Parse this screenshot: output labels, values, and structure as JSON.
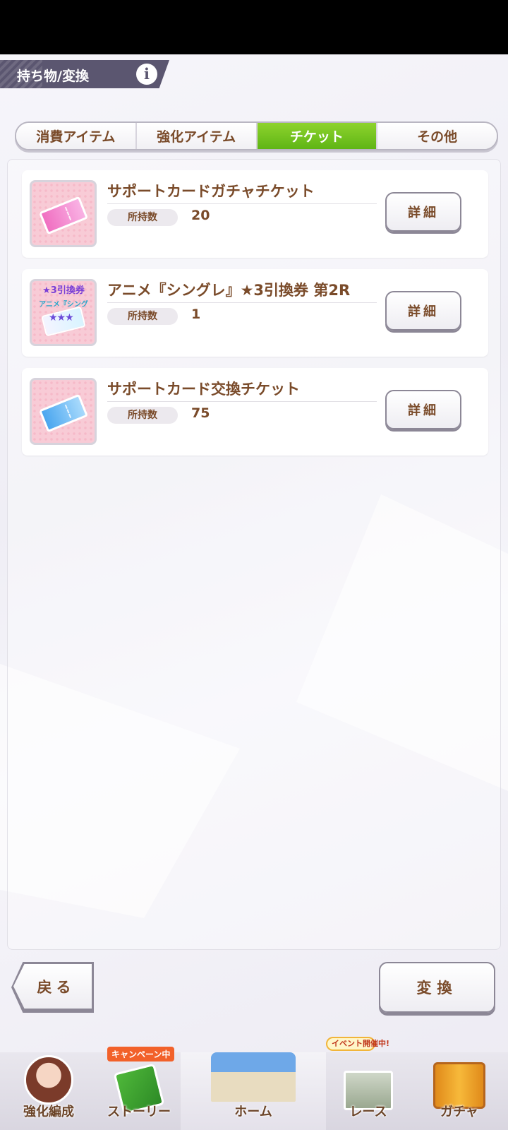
{
  "header": {
    "title": "持ち物/変換",
    "info_label": "i"
  },
  "tabs": [
    {
      "label": "消費アイテム",
      "active": false
    },
    {
      "label": "強化アイテム",
      "active": false
    },
    {
      "label": "チケット",
      "active": true
    },
    {
      "label": "その他",
      "active": false
    }
  ],
  "items": [
    {
      "name": "サポートカードガチャチケット",
      "owned_label": "所持数",
      "owned": "20",
      "detail_label": "詳細",
      "icon": "pink-ticket-icon"
    },
    {
      "name": "アニメ『シングレ』★3引換券 第2R",
      "owned_label": "所持数",
      "owned": "1",
      "detail_label": "詳細",
      "icon": "voucher-ticket-icon",
      "icon_text": "★3引換券",
      "icon_subtext": "アニメ『シングレ』"
    },
    {
      "name": "サポートカード交換チケット",
      "owned_label": "所持数",
      "owned": "75",
      "detail_label": "詳細",
      "icon": "blue-ticket-icon"
    }
  ],
  "buttons": {
    "back": "戻る",
    "convert": "変換"
  },
  "nav": {
    "items": [
      {
        "label": "強化編成"
      },
      {
        "label": "ストーリー",
        "badge": "キャンペーン中"
      },
      {
        "label": "ホーム"
      },
      {
        "label": "レース",
        "badge": "イベント開催中!"
      },
      {
        "label": "ガチャ"
      }
    ]
  },
  "colors": {
    "accent_green": "#6cc21c",
    "text_brown": "#7a4b2a",
    "header_bg": "#5b5670"
  }
}
